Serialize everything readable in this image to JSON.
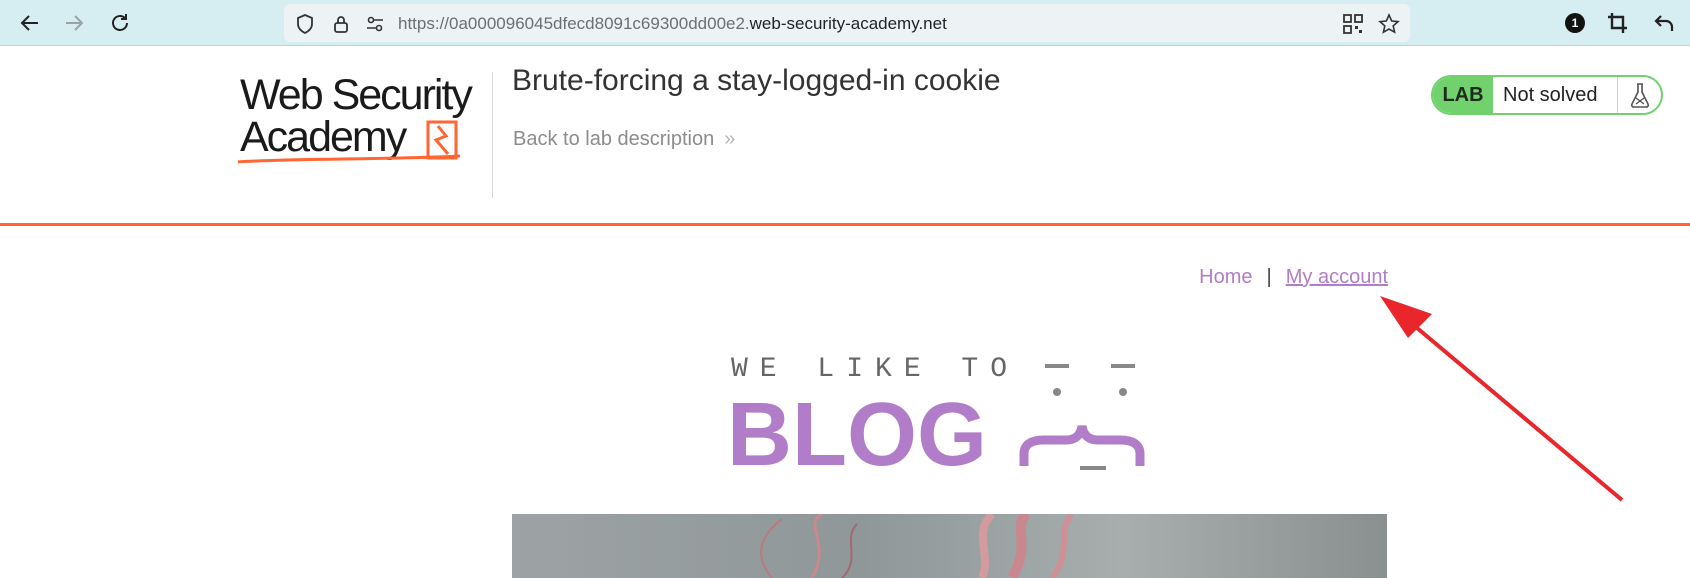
{
  "browser": {
    "url_prefix": "https://0a000096045dfecd8091c69300dd00e2.",
    "url_domain": "web-security-academy.net",
    "notification_count": "1"
  },
  "lab": {
    "logo_line1": "Web Security",
    "logo_line2": "Academy",
    "title": "Brute-forcing a stay-logged-in cookie",
    "back_link": "Back to lab description",
    "back_chevron": "»",
    "badge": "LAB",
    "status": "Not solved",
    "accent_color": "#ff6633",
    "status_color": "#70d16d"
  },
  "blog": {
    "nav": {
      "home": "Home",
      "separator": "|",
      "my_account": "My account"
    },
    "logo_tagline": "WE LIKE TO",
    "logo_word": "BLOG",
    "accent_color": "#b27dc8"
  },
  "annotation": {
    "arrow_color": "#e8262b"
  }
}
